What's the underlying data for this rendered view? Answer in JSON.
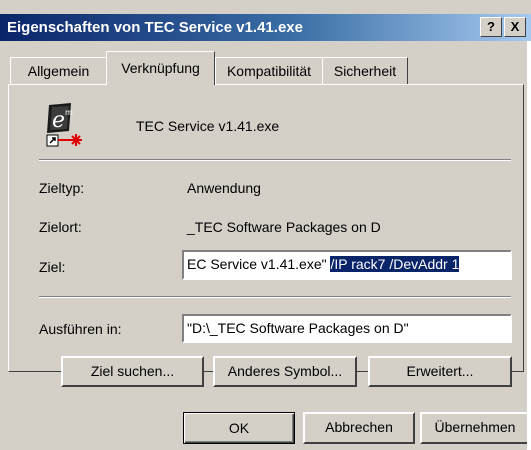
{
  "window": {
    "title": "Eigenschaften von TEC Service v1.41.exe",
    "help_btn": "?",
    "close_btn": "X"
  },
  "tabs": [
    {
      "label": "Allgemein",
      "active": false
    },
    {
      "label": "Verknüpfung",
      "active": true
    },
    {
      "label": "Kompatibilität",
      "active": false
    },
    {
      "label": "Sicherheit",
      "active": false
    }
  ],
  "shortcut": {
    "icon": "shortcut-app-icon",
    "name": "TEC Service v1.41.exe",
    "target_type_label": "Zieltyp:",
    "target_type_value": "Anwendung",
    "target_location_label": "Zielort:",
    "target_location_value": "_TEC Software Packages on D",
    "target_label": "Ziel:",
    "target_value_plain": "EC Service v1.41.exe\" ",
    "target_value_selected": "/IP rack7 /DevAddr 1",
    "run_in_label": "Ausführen in:",
    "run_in_value": "\"D:\\_TEC Software Packages on D\""
  },
  "buttons": {
    "find_target": "Ziel suchen...",
    "change_icon": "Anderes Symbol...",
    "advanced": "Erweitert...",
    "ok": "OK",
    "cancel": "Abbrechen",
    "apply": "Übernehmen"
  },
  "colors": {
    "face": "#d4d0c8",
    "selection": "#0a246a",
    "title_start": "#0a246a",
    "title_end": "#a6caf0"
  }
}
